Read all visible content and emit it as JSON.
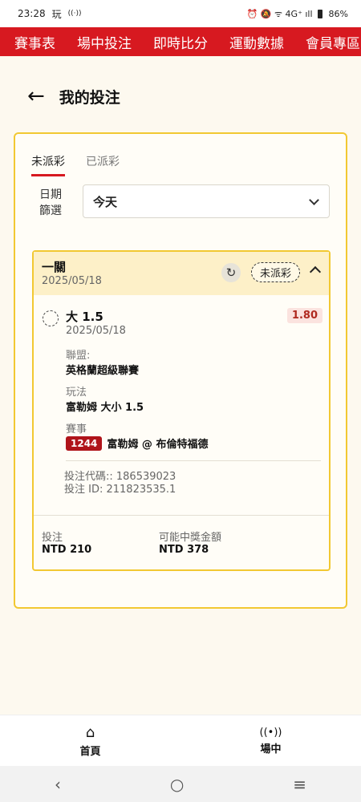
{
  "status_bar": {
    "time": "23:28",
    "carrier_icon": "玩",
    "signal": "((·))",
    "right_text": "⏰ 🔕 ᯤ 4G⁺ ıll",
    "battery": "86%"
  },
  "top_nav": [
    "賽事表",
    "場中投注",
    "即時比分",
    "運動數據",
    "會員專區"
  ],
  "header": {
    "back_icon": "←",
    "title": "我的投注"
  },
  "tabs": [
    {
      "label": "未派彩",
      "active": true
    },
    {
      "label": "已派彩",
      "active": false
    }
  ],
  "filter": {
    "label_line1": "日期",
    "label_line2": "篩選",
    "value": "今天"
  },
  "bet": {
    "type": "一關",
    "date": "2025/05/18",
    "status": "未派彩",
    "refresh_icon": "↻",
    "selection": {
      "name": "大 1.5",
      "date": "2025/05/18",
      "odds": "1.80",
      "league_label": "聯盟:",
      "league": "英格蘭超級聯賽",
      "market_label": "玩法",
      "market": "富勒姆 大小 1.5",
      "event_label": "賽事",
      "match_no": "1244",
      "match": "富勒姆 @ 布倫特福德"
    },
    "code_line": "投注代碼:: 186539023",
    "id_line": "投注 ID: 211823535.1",
    "stake_label": "投注",
    "stake": "NTD 210",
    "payout_label": "可能中獎金額",
    "payout": "NTD 378"
  },
  "bottom_nav": [
    {
      "label": "首頁",
      "icon": "⌂"
    },
    {
      "label": "場中",
      "icon": "((•))"
    }
  ],
  "system_nav": {
    "back": "‹",
    "home": "○",
    "recent": "≡"
  }
}
